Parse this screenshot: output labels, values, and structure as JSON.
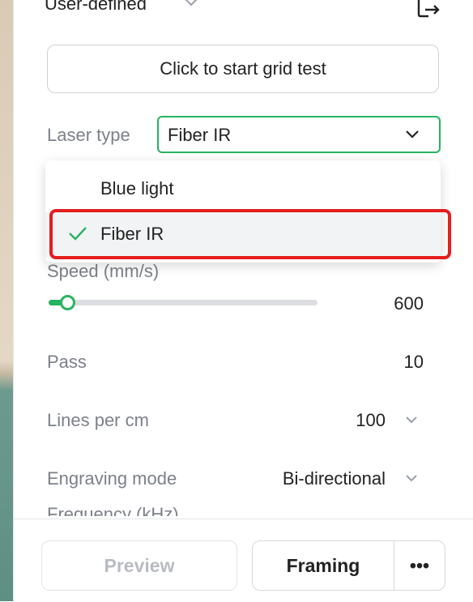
{
  "preset": {
    "value": "User-defined"
  },
  "grid_test": {
    "label": "Click to start grid test"
  },
  "laser_type": {
    "label": "Laser type",
    "selected": "Fiber IR",
    "options": [
      {
        "label": "Blue light",
        "checked": false
      },
      {
        "label": "Fiber IR",
        "checked": true
      }
    ]
  },
  "speed": {
    "label": "Speed (mm/s)",
    "value": "600",
    "fraction": 0.07
  },
  "pass": {
    "label": "Pass",
    "value": "10"
  },
  "lines_per_cm": {
    "label": "Lines per cm",
    "value": "100"
  },
  "engraving_mode": {
    "label": "Engraving mode",
    "value": "Bi-directional"
  },
  "frequency": {
    "label": "Frequency (kHz)"
  },
  "footer": {
    "preview_label": "Preview",
    "framing_label": "Framing",
    "more_label": "•••"
  },
  "colors": {
    "accent": "#27b360",
    "highlight": "#e51d1d"
  },
  "icons": [
    "chevron-down-icon",
    "export-icon",
    "check-icon",
    "more-icon"
  ]
}
